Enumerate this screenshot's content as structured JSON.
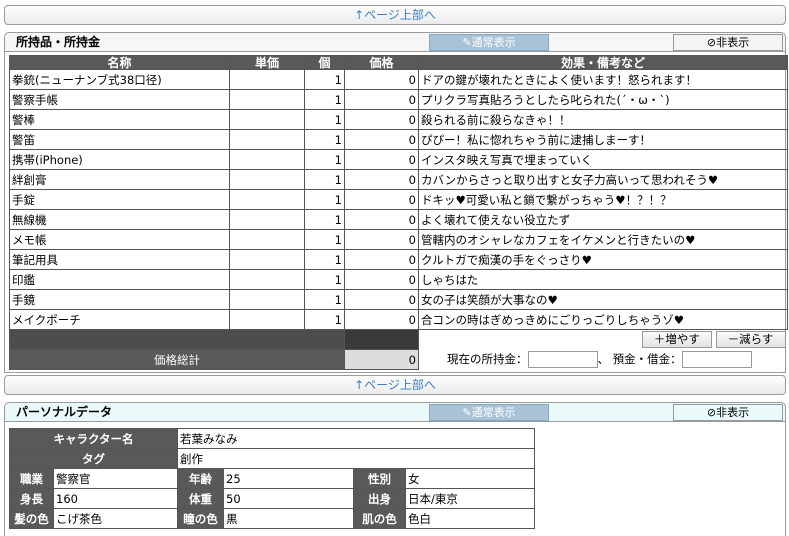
{
  "nav": {
    "page_top": "↑ページ上部へ"
  },
  "inventory": {
    "title": "所持品・所持金",
    "view_normal": "通常表示",
    "view_hide": "非表示",
    "columns": {
      "name": "名称",
      "unit_price": "単価",
      "count": "個",
      "price": "価格",
      "note": "効果・備考など"
    },
    "items": [
      {
        "name": "拳銃(ニューナンブ式38口径)",
        "unit_price": "",
        "count": "1",
        "price": "0",
        "note": "ドアの鍵が壊れたときによく使います！怒られます！"
      },
      {
        "name": "警察手帳",
        "unit_price": "",
        "count": "1",
        "price": "0",
        "note": "プリクラ写真貼ろうとしたら叱られた(´・ω・`)"
      },
      {
        "name": "警棒",
        "unit_price": "",
        "count": "1",
        "price": "0",
        "note": "殺られる前に殺らなきゃ！！"
      },
      {
        "name": "警笛",
        "unit_price": "",
        "count": "1",
        "price": "0",
        "note": "ぴぴー！私に惚れちゃう前に逮捕しまーす！"
      },
      {
        "name": "携帯(iPhone)",
        "unit_price": "",
        "count": "1",
        "price": "0",
        "note": "インスタ映え写真で埋まっていく"
      },
      {
        "name": "絆創膏",
        "unit_price": "",
        "count": "1",
        "price": "0",
        "note": "カバンからさっと取り出すと女子力高いって思われそう♥"
      },
      {
        "name": "手錠",
        "unit_price": "",
        "count": "1",
        "price": "0",
        "note": "ドキッ♥可愛い私と鎖で繋がっちゃう♥！？！？"
      },
      {
        "name": "無線機",
        "unit_price": "",
        "count": "1",
        "price": "0",
        "note": "よく壊れて使えない役立たず"
      },
      {
        "name": "メモ帳",
        "unit_price": "",
        "count": "1",
        "price": "0",
        "note": "管轄内のオシャレなカフェをイケメンと行きたいの♥"
      },
      {
        "name": "筆記用具",
        "unit_price": "",
        "count": "1",
        "price": "0",
        "note": "クルトガで痴漢の手をぐっさり♥"
      },
      {
        "name": "印鑑",
        "unit_price": "",
        "count": "1",
        "price": "0",
        "note": "しゃちはた"
      },
      {
        "name": "手鏡",
        "unit_price": "",
        "count": "1",
        "price": "0",
        "note": "女の子は笑顔が大事なの♥"
      },
      {
        "name": "メイクポーチ",
        "unit_price": "",
        "count": "1",
        "price": "0",
        "note": "合コンの時はぎめっきめにごりっごりしちゃうゾ♥"
      }
    ],
    "add_label": "＋増やす",
    "remove_label": "－減らす",
    "total_label": "価格総計",
    "total_value": "0",
    "money_label": "現在の所持金：",
    "deposit_label": "、 預金・借金："
  },
  "personal": {
    "title": "パーソナルデータ",
    "view_normal": "通常表示",
    "view_hide": "非表示",
    "character_name_label": "キャラクター名",
    "character_name": "若葉みなみ",
    "tag_label": "タグ",
    "tag": "創作",
    "job_label": "職業",
    "job": "警察官",
    "age_label": "年齢",
    "age": "25",
    "sex_label": "性別",
    "sex": "女",
    "height_label": "身長",
    "height": "160",
    "weight_label": "体重",
    "weight": "50",
    "origin_label": "出身",
    "origin": "日本/東京",
    "hair_label": "髪の色",
    "hair": "こげ茶色",
    "eye_label": "瞳の色",
    "eye": "黒",
    "skin_label": "肌の色",
    "skin": "色白"
  }
}
